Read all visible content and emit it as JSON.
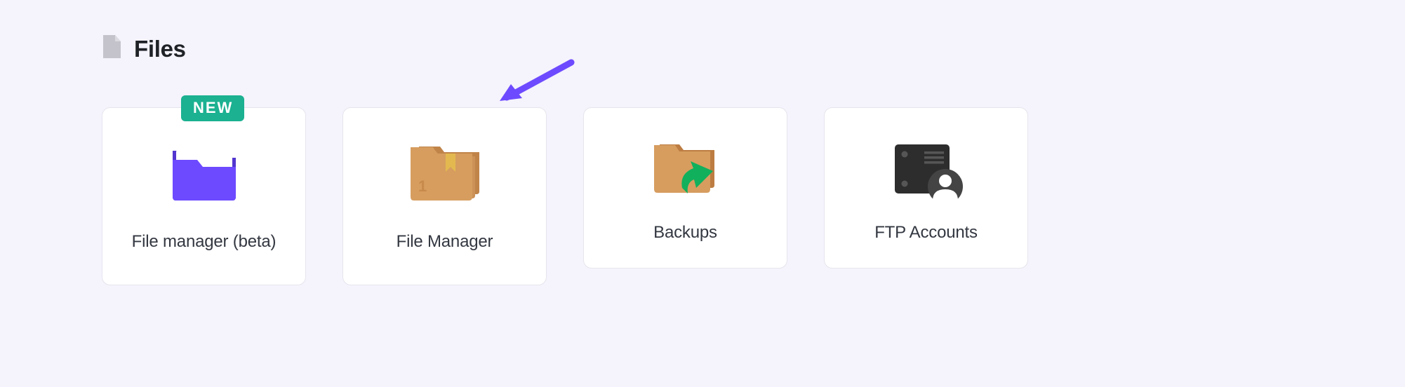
{
  "section": {
    "title": "Files"
  },
  "cards": [
    {
      "label": "File manager (beta)",
      "badge": "NEW"
    },
    {
      "label": "File Manager"
    },
    {
      "label": "Backups"
    },
    {
      "label": "FTP Accounts"
    }
  ],
  "colors": {
    "accent_purple": "#6d4aff",
    "badge_green": "#1bb191",
    "folder_brown": "#c88a4a",
    "folder_brown_dark": "#a46b39",
    "server_dark": "#2d2d2d",
    "arrow_green": "#11b05c"
  }
}
